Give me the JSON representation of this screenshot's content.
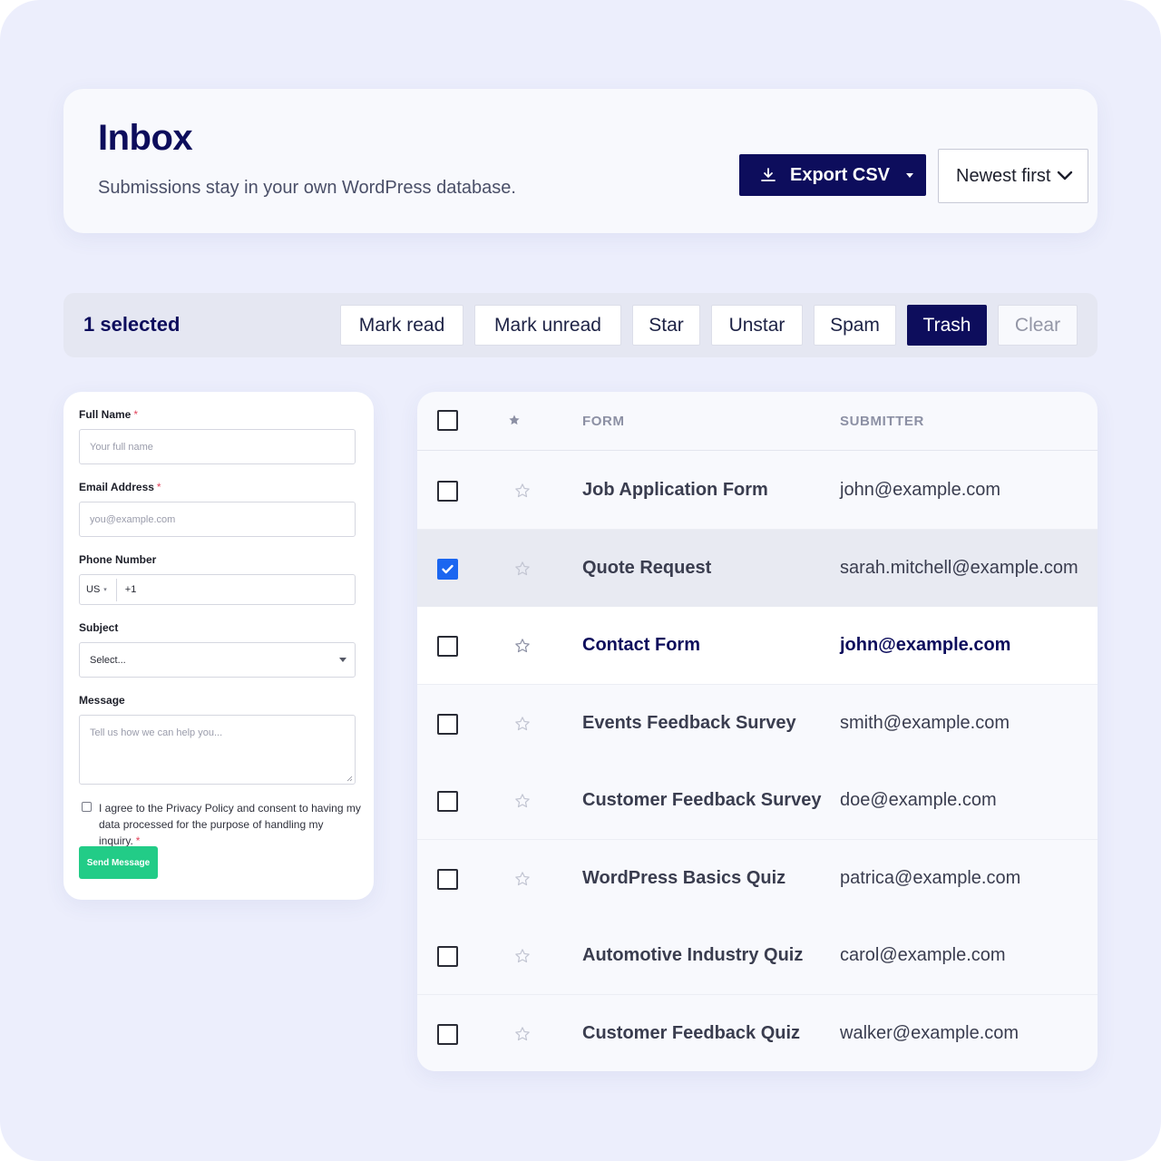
{
  "header": {
    "title": "Inbox",
    "subtitle": "Submissions stay in your own WordPress database.",
    "export_label": "Export CSV",
    "sort_label": "Newest first"
  },
  "bulk": {
    "selected_text": "1 selected",
    "actions": [
      "Mark read",
      "Mark unread",
      "Star",
      "Unstar",
      "Spam",
      "Trash",
      "Clear"
    ]
  },
  "form": {
    "full_name_label": "Full Name",
    "full_name_placeholder": "Your full name",
    "email_label": "Email Address",
    "email_placeholder": "you@example.com",
    "phone_label": "Phone Number",
    "phone_country": "US",
    "phone_code": "+1",
    "subject_label": "Subject",
    "subject_value": "Select...",
    "message_label": "Message",
    "message_placeholder": "Tell us how we can help you...",
    "consent_text": "I agree to the Privacy Policy and consent to having my data processed for the purpose of handling my inquiry.",
    "required_mark": "*",
    "send_label": "Send Message"
  },
  "table": {
    "col_form": "FORM",
    "col_submitter": "SUBMITTER",
    "rows": [
      {
        "form": "Job Application Form",
        "submitter": "john@example.com",
        "checked": false,
        "unread": false
      },
      {
        "form": "Quote Request",
        "submitter": "sarah.mitchell@example.com",
        "checked": true,
        "unread": false
      },
      {
        "form": "Contact Form",
        "submitter": "john@example.com",
        "checked": false,
        "unread": true
      },
      {
        "form": "Events Feedback Survey",
        "submitter": "smith@example.com",
        "checked": false,
        "unread": false
      },
      {
        "form": "Customer Feedback Survey",
        "submitter": "doe@example.com",
        "checked": false,
        "unread": false
      },
      {
        "form": "WordPress Basics Quiz",
        "submitter": "patrica@example.com",
        "checked": false,
        "unread": false
      },
      {
        "form": "Automotive Industry Quiz",
        "submitter": "carol@example.com",
        "checked": false,
        "unread": false
      },
      {
        "form": "Customer Feedback Quiz",
        "submitter": "walker@example.com",
        "checked": false,
        "unread": false
      }
    ]
  },
  "colors": {
    "brand_navy": "#0d0d5c",
    "accent_green": "#22cc87",
    "checkbox_blue": "#1b66f0",
    "required_red": "#e2445c"
  },
  "icons": {
    "export": "download-icon",
    "sort": "chevron-down-icon",
    "star": "star-icon",
    "check": "checkmark-icon"
  }
}
